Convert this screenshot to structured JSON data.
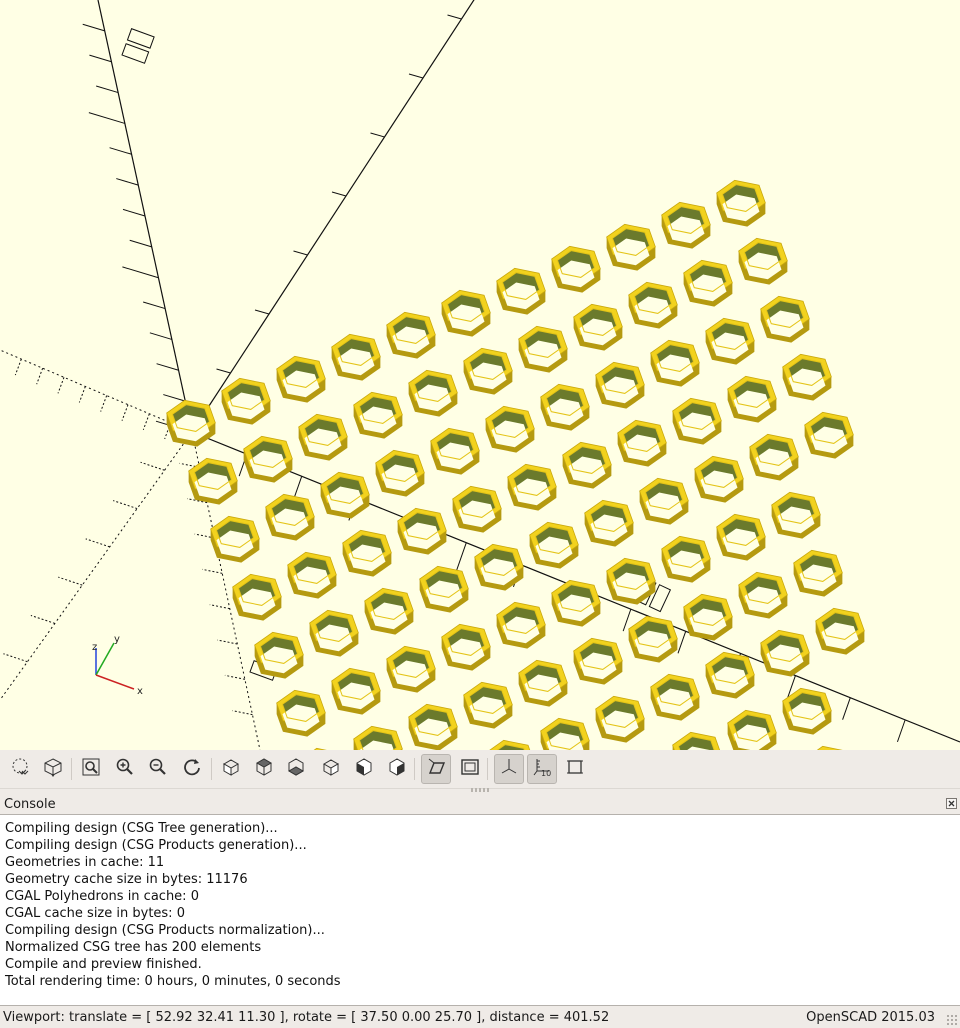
{
  "viewport": {
    "background": "#ffffe5",
    "model_color": "#f2d21e",
    "inner_wall_color": "#6b7a2c",
    "axis_labels": {
      "x": "x",
      "y": "y",
      "z": "z"
    }
  },
  "toolbar": {
    "buttons": [
      {
        "name": "preview-button",
        "icon": "preview-icon",
        "active": false
      },
      {
        "name": "render-button",
        "icon": "render-icon",
        "active": false
      },
      {
        "name": "view-all-button",
        "icon": "zoom-all-icon",
        "active": false
      },
      {
        "name": "zoom-in-button",
        "icon": "zoom-in-icon",
        "active": false
      },
      {
        "name": "zoom-out-button",
        "icon": "zoom-out-icon",
        "active": false
      },
      {
        "name": "reset-view-button",
        "icon": "reset-icon",
        "active": false
      },
      {
        "name": "view-right-button",
        "icon": "view-right-icon",
        "active": false
      },
      {
        "name": "view-top-button",
        "icon": "view-top-icon",
        "active": false
      },
      {
        "name": "view-bottom-button",
        "icon": "view-bottom-icon",
        "active": false
      },
      {
        "name": "view-left-button",
        "icon": "view-left-icon",
        "active": false
      },
      {
        "name": "view-front-button",
        "icon": "view-front-icon",
        "active": false
      },
      {
        "name": "view-back-button",
        "icon": "view-back-icon",
        "active": false
      },
      {
        "name": "perspective-button",
        "icon": "perspective-icon",
        "active": true
      },
      {
        "name": "orthogonal-button",
        "icon": "orthogonal-icon",
        "active": false
      },
      {
        "name": "show-axes-button",
        "icon": "axes-icon",
        "active": true
      },
      {
        "name": "show-scale-button",
        "icon": "scale-markers-icon",
        "active": true,
        "label": "10"
      },
      {
        "name": "show-edges-button",
        "icon": "edges-icon",
        "active": false
      }
    ]
  },
  "console": {
    "title": "Console",
    "lines": [
      "Compiling design (CSG Tree generation)...",
      "Compiling design (CSG Products generation)...",
      "Geometries in cache: 11",
      "Geometry cache size in bytes: 11176",
      "CGAL Polyhedrons in cache: 0",
      "CGAL cache size in bytes: 0",
      "Compiling design (CSG Products normalization)...",
      "Normalized CSG tree has 200 elements",
      "Compile and preview finished.",
      "Total rendering time: 0 hours, 0 minutes, 0 seconds"
    ]
  },
  "statusbar": {
    "viewport_info": "Viewport: translate = [ 52.92 32.41 11.30 ], rotate = [ 37.50 0.00 25.70 ], distance = 401.52",
    "version": "OpenSCAD 2015.03"
  }
}
